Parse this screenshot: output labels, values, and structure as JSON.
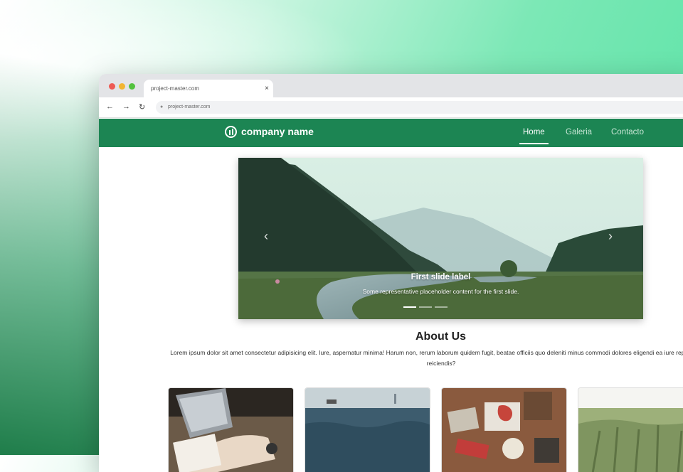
{
  "browser": {
    "tab_title": "project-master.com",
    "tab_close": "×",
    "url": "project-master.com",
    "back_icon": "←",
    "forward_icon": "→",
    "reload_icon": "↻",
    "lock_icon": "🔒"
  },
  "site": {
    "brand_name": "company name",
    "nav": [
      "Home",
      "Galeria",
      "Contacto"
    ],
    "active_nav": "Home",
    "brand_color": "#1c8553"
  },
  "carousel": {
    "caption_title": "First slide label",
    "caption_text": "Some representative placeholder content for the first slide.",
    "prev_icon": "‹",
    "next_icon": "›",
    "slide_count": 3,
    "active_slide": 1
  },
  "about": {
    "title": "About Us",
    "text": "Lorem ipsum dolor sit amet consectetur adipisicing elit. Iure, aspernatur minima! Harum non, rerum laborum quidem fugit, beatae officiis quo deleniti minus commodi dolores eligendi ea iure reprehenderit reiciendis?"
  },
  "gallery": {
    "cards": [
      "laptop-writing-photo",
      "sea-lighthouse-photo",
      "typography-desk-photo",
      "wheat-field-photo"
    ]
  }
}
